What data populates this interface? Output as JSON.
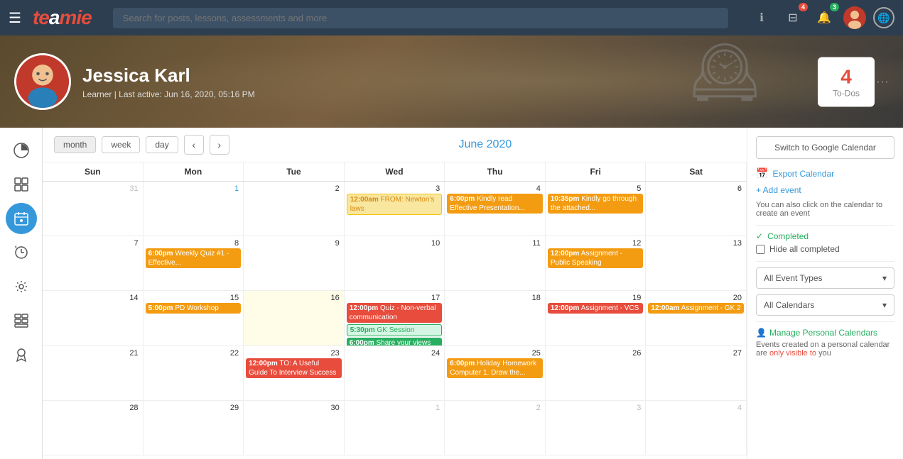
{
  "topnav": {
    "logo": "teamie",
    "search_placeholder": "Search for posts, lessons, assessments and more",
    "badge_box": "4",
    "badge_bell": "3"
  },
  "profile": {
    "name": "Jessica Karl",
    "meta": "Learner | Last active: Jun 16, 2020, 05:16 PM",
    "todos_count": "4",
    "todos_label": "To-Dos"
  },
  "sidebar": {
    "items": [
      {
        "id": "analytics",
        "icon": "◑",
        "label": "Analytics"
      },
      {
        "id": "grid",
        "icon": "⊞",
        "label": "Grid"
      },
      {
        "id": "calendar",
        "icon": "📅",
        "label": "Calendar"
      },
      {
        "id": "history",
        "icon": "↺",
        "label": "History"
      },
      {
        "id": "settings",
        "icon": "⚙",
        "label": "Settings"
      },
      {
        "id": "dashboard",
        "icon": "▦",
        "label": "Dashboard"
      },
      {
        "id": "badge",
        "icon": "🏅",
        "label": "Badge"
      }
    ]
  },
  "calendar": {
    "month_label": "June 2020",
    "view_month": "month",
    "view_week": "week",
    "view_day": "day",
    "headers": [
      "Sun",
      "Mon",
      "Tue",
      "Wed",
      "Thu",
      "Fri",
      "Sat"
    ],
    "switch_gcal": "Switch to Google Calendar",
    "export_label": "Export Calendar",
    "add_event_label": "+ Add event",
    "add_event_desc": "You can also click on the calendar to create an event",
    "completed_label": "Completed",
    "hide_completed": "Hide all completed",
    "event_types_label": "All Event Types",
    "all_calendars_label": "All Calendars",
    "manage_label": "Manage Personal Calendars",
    "manage_desc_pre": "Events created on a personal calendar are",
    "manage_desc_em": "only visible to",
    "manage_desc_post": "you",
    "weeks": [
      [
        {
          "date": "31",
          "other": true,
          "events": []
        },
        {
          "date": "1",
          "highlight": true,
          "events": []
        },
        {
          "date": "2",
          "events": []
        },
        {
          "date": "3",
          "events": [
            {
              "cls": "yellow",
              "time": "12:00am",
              "text": "FROM: Newton's laws"
            }
          ]
        },
        {
          "date": "4",
          "events": [
            {
              "cls": "orange",
              "time": "6:00pm",
              "text": "Kindly read Effective Presentation..."
            }
          ]
        },
        {
          "date": "5",
          "events": [
            {
              "cls": "orange",
              "time": "10:35pm",
              "text": "Kindly go through the attached..."
            }
          ]
        },
        {
          "date": "6",
          "events": []
        }
      ],
      [
        {
          "date": "7",
          "events": []
        },
        {
          "date": "8",
          "events": [
            {
              "cls": "orange",
              "time": "6:00pm",
              "text": "Weekly Quiz #1 - Effective..."
            }
          ]
        },
        {
          "date": "9",
          "events": []
        },
        {
          "date": "10",
          "events": []
        },
        {
          "date": "11",
          "events": []
        },
        {
          "date": "12",
          "events": [
            {
              "cls": "orange",
              "time": "12:00pm",
              "text": "Assignment - Public Speaking"
            }
          ]
        },
        {
          "date": "13",
          "events": []
        }
      ],
      [
        {
          "date": "14",
          "events": []
        },
        {
          "date": "15",
          "events": [
            {
              "cls": "orange",
              "time": "5:00pm",
              "text": "PD Workshop"
            }
          ]
        },
        {
          "date": "16",
          "today": true,
          "events": []
        },
        {
          "date": "17",
          "events": [
            {
              "cls": "red",
              "time": "12:00pm",
              "text": "Quiz - Non-verbal communication"
            },
            {
              "cls": "light-green",
              "time": "5:30pm",
              "text": "GK Session"
            },
            {
              "cls": "green",
              "time": "6:00pm",
              "text": "Share your views on E-learning!"
            }
          ]
        },
        {
          "date": "18",
          "events": []
        },
        {
          "date": "19",
          "events": [
            {
              "cls": "red",
              "time": "12:00pm",
              "text": "Assignment - VCS"
            }
          ]
        },
        {
          "date": "20",
          "events": [
            {
              "cls": "orange",
              "time": "12:00am",
              "text": "Assignment - GK 2"
            }
          ]
        }
      ],
      [
        {
          "date": "21",
          "events": []
        },
        {
          "date": "22",
          "events": []
        },
        {
          "date": "23",
          "events": [
            {
              "cls": "red",
              "time": "12:00pm",
              "text": "TO: A Useful Guide To Interview Success"
            }
          ]
        },
        {
          "date": "24",
          "events": []
        },
        {
          "date": "25",
          "events": [
            {
              "cls": "orange",
              "time": "6:00pm",
              "text": "Holiday Homework Computer 1. Draw the..."
            }
          ]
        },
        {
          "date": "26",
          "events": []
        },
        {
          "date": "27",
          "events": []
        }
      ],
      [
        {
          "date": "28",
          "events": []
        },
        {
          "date": "29",
          "events": []
        },
        {
          "date": "30",
          "events": []
        },
        {
          "date": "1",
          "other": true,
          "events": []
        },
        {
          "date": "2",
          "other": true,
          "events": []
        },
        {
          "date": "3",
          "other": true,
          "events": []
        },
        {
          "date": "4",
          "other": true,
          "events": []
        }
      ]
    ]
  }
}
